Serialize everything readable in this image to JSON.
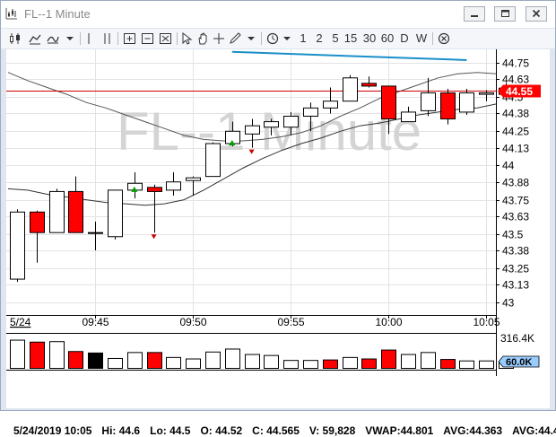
{
  "window": {
    "title": "FL--1 Minute"
  },
  "toolbar": {
    "intervals": [
      "1",
      "2",
      "5",
      "15",
      "30",
      "60",
      "D",
      "W"
    ]
  },
  "chart": {
    "watermark": "FL--1 Minute",
    "current_price": "44.55",
    "date_label": "5/24",
    "volume_max_label": "316.4K",
    "volume_marker": "60.0K"
  },
  "chart_data": {
    "type": "candlestick",
    "y_ticks": [
      44.75,
      44.63,
      44.5,
      44.38,
      44.25,
      44.13,
      44,
      43.88,
      43.75,
      43.63,
      43.5,
      43.38,
      43.25,
      43.13,
      43
    ],
    "y_tick_labels": [
      "44.75",
      "44.63",
      "44.5",
      "44.38",
      "44.25",
      "44.13",
      "44",
      "43.88",
      "43.75",
      "43.63",
      "43.5",
      "43.38",
      "43.25",
      "43.13",
      "43"
    ],
    "ylim": [
      42.98,
      44.83
    ],
    "x_tick_labels": [
      "09:45",
      "09:50",
      "09:55",
      "10:00",
      "10:05"
    ],
    "x_tick_index": [
      4,
      9,
      14,
      19,
      24
    ],
    "current_price_line": 44.55,
    "candles": [
      {
        "o": 43.17,
        "h": 43.68,
        "l": 43.15,
        "c": 43.66
      },
      {
        "o": 43.66,
        "h": 43.67,
        "l": 43.29,
        "c": 43.51
      },
      {
        "o": 43.51,
        "h": 43.83,
        "l": 43.51,
        "c": 43.81
      },
      {
        "o": 43.81,
        "h": 43.92,
        "l": 43.51,
        "c": 43.51
      },
      {
        "o": 43.51,
        "h": 43.59,
        "l": 43.38,
        "c": 43.51
      },
      {
        "o": 43.48,
        "h": 43.82,
        "l": 43.46,
        "c": 43.82
      },
      {
        "o": 43.82,
        "h": 43.95,
        "l": 43.76,
        "c": 43.87
      },
      {
        "o": 43.84,
        "h": 43.86,
        "l": 43.51,
        "c": 43.81
      },
      {
        "o": 43.82,
        "h": 43.95,
        "l": 43.78,
        "c": 43.88
      },
      {
        "o": 43.89,
        "h": 43.92,
        "l": 43.78,
        "c": 43.91
      },
      {
        "o": 43.92,
        "h": 44.17,
        "l": 43.92,
        "c": 44.16
      },
      {
        "o": 44.16,
        "h": 44.32,
        "l": 44.14,
        "c": 44.25
      },
      {
        "o": 44.23,
        "h": 44.34,
        "l": 44.13,
        "c": 44.29
      },
      {
        "o": 44.28,
        "h": 44.34,
        "l": 44.22,
        "c": 44.32
      },
      {
        "o": 44.28,
        "h": 44.39,
        "l": 44.22,
        "c": 44.36
      },
      {
        "o": 44.36,
        "h": 44.46,
        "l": 44.25,
        "c": 44.42
      },
      {
        "o": 44.42,
        "h": 44.57,
        "l": 44.38,
        "c": 44.47
      },
      {
        "o": 44.47,
        "h": 44.66,
        "l": 44.47,
        "c": 44.64
      },
      {
        "o": 44.6,
        "h": 44.65,
        "l": 44.57,
        "c": 44.58
      },
      {
        "o": 44.58,
        "h": 44.58,
        "l": 44.23,
        "c": 44.34
      },
      {
        "o": 44.32,
        "h": 44.43,
        "l": 44.32,
        "c": 44.39
      },
      {
        "o": 44.4,
        "h": 44.64,
        "l": 44.36,
        "c": 44.53
      },
      {
        "o": 44.53,
        "h": 44.56,
        "l": 44.3,
        "c": 44.34
      },
      {
        "o": 44.39,
        "h": 44.56,
        "l": 44.37,
        "c": 44.53
      },
      {
        "o": 44.52,
        "h": 44.55,
        "l": 44.47,
        "c": 44.53
      },
      {
        "o": 44.52,
        "h": 44.6,
        "l": 44.5,
        "c": 44.565
      }
    ],
    "signals_up": [
      6,
      11
    ],
    "signals_down": [
      7,
      12
    ],
    "moving_average_fast": [
      43.83,
      43.82,
      43.79,
      43.77,
      43.75,
      43.73,
      43.72,
      43.71,
      43.72,
      43.75,
      43.82,
      43.9,
      43.98,
      44.05,
      44.11,
      44.16,
      44.2,
      44.25,
      44.29,
      44.31,
      44.34,
      44.37,
      44.39,
      44.41,
      44.42,
      44.45
    ],
    "moving_average_slow": [
      44.68,
      44.62,
      44.57,
      44.52,
      44.46,
      44.42,
      44.37,
      44.32,
      44.27,
      44.22,
      44.19,
      44.18,
      44.18,
      44.19,
      44.21,
      44.24,
      44.29,
      44.36,
      44.42,
      44.49,
      44.54,
      44.59,
      44.64,
      44.67,
      44.68,
      44.67
    ],
    "trendline": {
      "from_index": 11,
      "from_value": 44.83,
      "to_index": 23,
      "to_value": 44.77
    },
    "volume": [
      {
        "v": 0.285,
        "dir": "up"
      },
      {
        "v": 0.265,
        "dir": "down"
      },
      {
        "v": 0.27,
        "dir": "up"
      },
      {
        "v": 0.17,
        "dir": "down"
      },
      {
        "v": 0.155,
        "dir": "black"
      },
      {
        "v": 0.1,
        "dir": "up"
      },
      {
        "v": 0.16,
        "dir": "up"
      },
      {
        "v": 0.16,
        "dir": "down"
      },
      {
        "v": 0.11,
        "dir": "up"
      },
      {
        "v": 0.095,
        "dir": "up"
      },
      {
        "v": 0.165,
        "dir": "up"
      },
      {
        "v": 0.195,
        "dir": "up"
      },
      {
        "v": 0.14,
        "dir": "up"
      },
      {
        "v": 0.13,
        "dir": "up"
      },
      {
        "v": 0.08,
        "dir": "up"
      },
      {
        "v": 0.08,
        "dir": "up"
      },
      {
        "v": 0.085,
        "dir": "down"
      },
      {
        "v": 0.11,
        "dir": "up"
      },
      {
        "v": 0.095,
        "dir": "down"
      },
      {
        "v": 0.185,
        "dir": "down"
      },
      {
        "v": 0.14,
        "dir": "up"
      },
      {
        "v": 0.16,
        "dir": "up"
      },
      {
        "v": 0.09,
        "dir": "down"
      },
      {
        "v": 0.075,
        "dir": "up"
      },
      {
        "v": 0.075,
        "dir": "up"
      },
      {
        "v": 0.06,
        "dir": "up"
      }
    ]
  },
  "status": {
    "date_time": "5/24/2019 10:05",
    "high": "Hi: 44.6",
    "low": "Lo: 44.5",
    "open": "O: 44.52",
    "close": "C: 44.565",
    "volume": "V: 59,828",
    "vwap": "VWAP:44.801",
    "avg1": "AVG:44.363",
    "avg2": "AVG:44.4"
  },
  "colors": {
    "up_candle": "#ffffff",
    "down_candle": "#ff0000",
    "price_line": "#cc0000",
    "trendline": "#1a8fc9",
    "signal_up": "#00a000",
    "signal_down": "#cc0000"
  }
}
